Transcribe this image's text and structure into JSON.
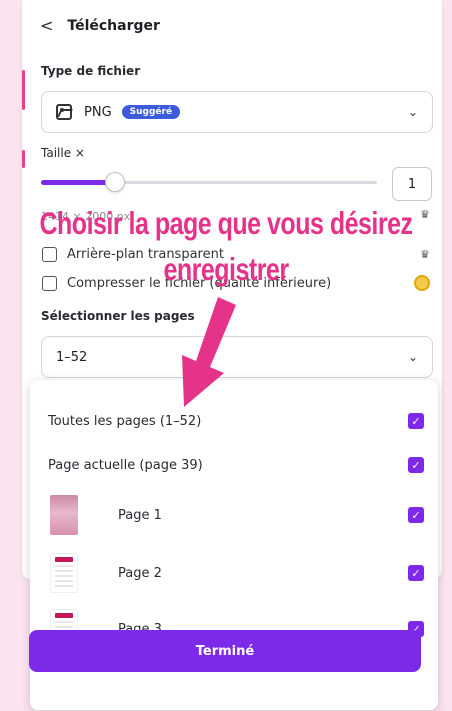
{
  "header": {
    "title": "Télécharger",
    "back_glyph": "<"
  },
  "file_type": {
    "label": "Type de fichier",
    "value": "PNG",
    "badge": "Suggéré",
    "icon": "image-file-icon"
  },
  "size": {
    "label": "Taille ×",
    "value": "1",
    "slider_level": 0.22,
    "dimensions": "1414 × 2000 px"
  },
  "options": [
    {
      "label": "Arrière-plan transparent",
      "checked": false,
      "icon": "crown-icon"
    },
    {
      "label": "Compresser le fichier (qualité inférieure)",
      "checked": false,
      "icon": "coin-icon"
    }
  ],
  "pages": {
    "label": "Sélectionner les pages",
    "value": "1–52"
  },
  "dropdown_items": [
    {
      "label": "Toutes les pages (1–52)",
      "checked": true
    },
    {
      "label": "Page actuelle (page 39)",
      "checked": true
    },
    {
      "label": "Page 1",
      "checked": true,
      "thumb": "thumb1"
    },
    {
      "label": "Page 2",
      "checked": true,
      "thumb": "thumb2"
    },
    {
      "label": "Page 3",
      "checked": true,
      "thumb": "thumb3"
    }
  ],
  "done_button": "Terminé",
  "overlay": {
    "line1": "Choisir la page que vous désirez",
    "line2": "enregistrer"
  },
  "colors": {
    "accent": "#7d2ae8",
    "overlay": "#e6338a",
    "badge": "#3b5bdb",
    "background": "#fbe4f0"
  }
}
